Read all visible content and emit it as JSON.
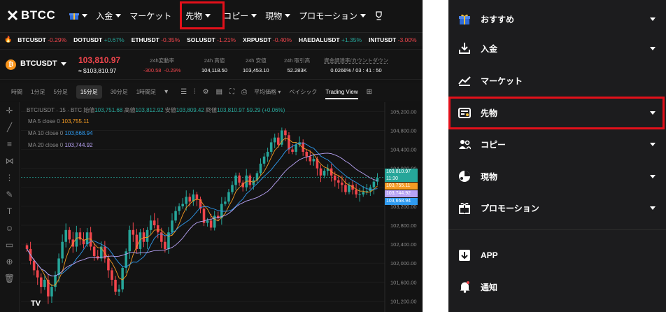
{
  "header": {
    "logo": "BTCC",
    "nav": [
      "入金",
      "マーケット",
      "先物",
      "コピー",
      "現物",
      "プロモーション"
    ]
  },
  "ticker": [
    {
      "sym": "BTCUSDT",
      "chg": "-0.29%",
      "dir": "dn"
    },
    {
      "sym": "DOTUSDT",
      "chg": "+0.67%",
      "dir": "up"
    },
    {
      "sym": "ETHUSDT",
      "chg": "-0.35%",
      "dir": "dn"
    },
    {
      "sym": "SOLUSDT",
      "chg": "-1.21%",
      "dir": "dn"
    },
    {
      "sym": "XRPUSDT",
      "chg": "-0.40%",
      "dir": "dn"
    },
    {
      "sym": "HAEDALUSDT",
      "chg": "+1.35%",
      "dir": "up"
    },
    {
      "sym": "INITUSDT",
      "chg": "-3.00%",
      "dir": "dn"
    }
  ],
  "symbol": {
    "coin": "₿",
    "pair": "BTCUSDT",
    "price": "103,810.97",
    "approx": "≈ $103,810.97",
    "stats": [
      {
        "label": "24h変動率",
        "value_a": "-300.58",
        "value_b": "-0.29%"
      },
      {
        "label": "24h 高値",
        "value": "104,118.50"
      },
      {
        "label": "24h 安値",
        "value": "103,453.10"
      },
      {
        "label": "24h 取引高",
        "value": "52.283K"
      },
      {
        "label": "資金調達率/カウントダウン",
        "value": "0.0266% / 03 : 41 : 50"
      }
    ]
  },
  "toolbar": {
    "intervals": [
      "時間",
      "1分足",
      "5分足",
      "15分足",
      "30分足",
      "1時間足"
    ],
    "selected": "15分足",
    "avg_price": "平均価格",
    "basic": "ベイシック",
    "trading_view": "Trading View"
  },
  "legend": {
    "title": "BTC/USDT · 15 · BTC",
    "open_l": "始値",
    "open": "103,751.68",
    "high_l": "高値",
    "high": "103,812.92",
    "low_l": "安値",
    "low": "103,809.42",
    "close_l": "終値",
    "close": "103,810.97",
    "chg": "59.29 (+0.06%)",
    "ma": [
      {
        "label": "MA 5 close 0",
        "value": "103,755.11",
        "color": "#f59b23"
      },
      {
        "label": "MA 10 close 0",
        "value": "103,668.94",
        "color": "#2f9bf0"
      },
      {
        "label": "MA 20 close 0",
        "value": "103,744.92",
        "color": "#b8a3f5"
      }
    ]
  },
  "price_labels": [
    {
      "value": "103,810.97",
      "sub": "11:30",
      "color": "#26a69a"
    },
    {
      "value": "103,755.11",
      "color": "#f59b23"
    },
    {
      "value": "103,744.92",
      "color": "#b8a3f5"
    },
    {
      "value": "103,668.94",
      "color": "#2f9bf0"
    }
  ],
  "chart_data": {
    "type": "candlestick",
    "title": "BTC/USDT · 15 · BTC",
    "xlabel": "",
    "ylabel": "",
    "ylim": [
      101000,
      105250
    ],
    "y_ticks": [
      "105,200.00",
      "104,800.00",
      "104,400.00",
      "104,000.00",
      "103,600.00",
      "103,200.00",
      "102,800.00",
      "102,400.00",
      "102,000.00",
      "101,600.00",
      "101,200.00"
    ],
    "closes": [
      102300,
      102050,
      101850,
      101700,
      101500,
      101650,
      101300,
      101500,
      101750,
      102100,
      102450,
      102700,
      102500,
      102350,
      102650,
      102500,
      102400,
      102650,
      102350,
      102150,
      102100,
      102350,
      102100,
      101850,
      101650,
      101400,
      101450,
      101900,
      102250,
      102700,
      102600,
      102300,
      102650,
      102450,
      102700,
      102900,
      102800,
      102650,
      102450,
      102300,
      102650,
      102900,
      103100,
      103200,
      103250,
      103400,
      103300,
      103450,
      103350,
      103150,
      102850,
      102900,
      102750,
      103000,
      102950,
      103250,
      103300,
      103500,
      103650,
      103850,
      103700,
      103600,
      103850,
      103650,
      103750,
      103900,
      104100,
      104250,
      104350,
      104550,
      104650,
      104500,
      104800,
      104700,
      104400,
      104350,
      104500,
      104550,
      104350,
      104250,
      104150,
      104200,
      104000,
      103850,
      103950,
      104000,
      103850,
      103750,
      103700,
      103650,
      103500,
      103650,
      103550,
      103450,
      103450,
      103500,
      103520,
      103600,
      103720,
      103800
    ],
    "ma_series": [
      {
        "name": "MA 5 close 0",
        "color": "#f59b23"
      },
      {
        "name": "MA 10 close 0",
        "color": "#2f9bf0"
      },
      {
        "name": "MA 20 close 0",
        "color": "#b8a3f5"
      }
    ],
    "last_price": 103810.97,
    "up_color": "#26a69a",
    "down_color": "#f0454c"
  },
  "menu": [
    {
      "label": "おすすめ",
      "icon": "gift-icon",
      "caret": true
    },
    {
      "label": "入金",
      "icon": "deposit-icon",
      "caret": true
    },
    {
      "label": "マーケット",
      "icon": "market-chart-icon",
      "caret": false
    },
    {
      "label": "先物",
      "icon": "futures-icon",
      "caret": true
    },
    {
      "label": "コピー",
      "icon": "copy-trade-icon",
      "caret": true
    },
    {
      "label": "現物",
      "icon": "spot-icon",
      "caret": true
    },
    {
      "label": "プロモーション",
      "icon": "promotion-gift-icon",
      "caret": true
    },
    {
      "label": "APP",
      "icon": "app-download-icon",
      "caret": false
    },
    {
      "label": "通知",
      "icon": "bell-icon",
      "caret": false
    }
  ],
  "colors": {
    "highlight": "#e3101a",
    "accent_green": "#26a69a",
    "accent_red": "#f0454c"
  }
}
